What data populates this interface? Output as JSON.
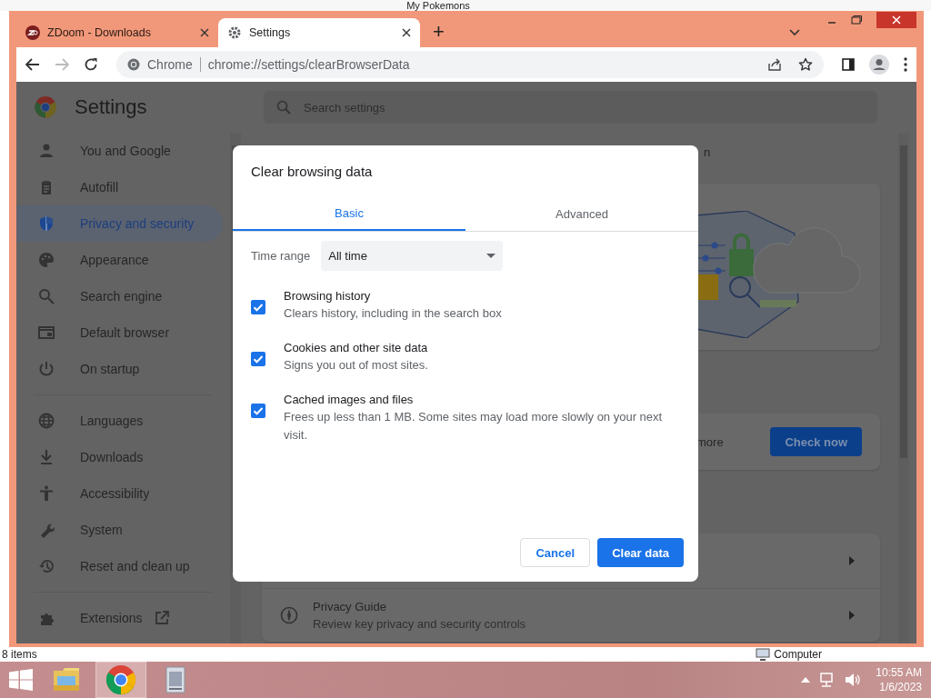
{
  "desktop": {
    "behind_window_title": "My Pokemons",
    "status_left": "8 items",
    "status_right": "Computer"
  },
  "browser": {
    "tabs": [
      {
        "title": "ZDoom - Downloads",
        "selected": false
      },
      {
        "title": "Settings",
        "selected": true
      }
    ],
    "new_tab": "+",
    "address": {
      "chip": "Chrome",
      "url": "chrome://settings/clearBrowserData"
    }
  },
  "settings": {
    "title": "Settings",
    "search": {
      "placeholder": "Search settings"
    },
    "sidebar": {
      "groups": [
        {
          "items": [
            {
              "label": "You and Google",
              "selected": false
            },
            {
              "label": "Autofill",
              "selected": false
            },
            {
              "label": "Privacy and security",
              "selected": true
            },
            {
              "label": "Appearance",
              "selected": false
            },
            {
              "label": "Search engine",
              "selected": false
            },
            {
              "label": "Default browser",
              "selected": false
            },
            {
              "label": "On startup",
              "selected": false
            }
          ]
        },
        {
          "items": [
            {
              "label": "Languages",
              "selected": false
            },
            {
              "label": "Downloads",
              "selected": false
            },
            {
              "label": "Accessibility",
              "selected": false
            },
            {
              "label": "System",
              "selected": false
            },
            {
              "label": "Reset and clean up",
              "selected": false
            }
          ]
        },
        {
          "items": [
            {
              "label": "Extensions",
              "selected": false,
              "external": true
            }
          ]
        }
      ]
    },
    "main": {
      "heading_fragment": "n",
      "safety_check": {
        "text_fragment": "more",
        "button": "Check now"
      },
      "rows": [
        {
          "title": "Privacy Guide",
          "subtitle": "Review key privacy and security controls"
        }
      ]
    }
  },
  "dialog": {
    "title": "Clear browsing data",
    "tabs": [
      {
        "label": "Basic",
        "selected": true
      },
      {
        "label": "Advanced",
        "selected": false
      }
    ],
    "time_range": {
      "label": "Time range",
      "value": "All time"
    },
    "options": [
      {
        "title": "Browsing history",
        "description": "Clears history, including in the search box",
        "checked": true
      },
      {
        "title": "Cookies and other site data",
        "description": "Signs you out of most sites.",
        "checked": true
      },
      {
        "title": "Cached images and files",
        "description": "Frees up less than 1 MB. Some sites may load more slowly on your next visit.",
        "checked": true
      }
    ],
    "buttons": [
      {
        "label": "Cancel",
        "kind": "secondary"
      },
      {
        "label": "Clear data",
        "kind": "primary"
      }
    ]
  },
  "taskbar": {
    "apps": [
      {
        "selected": false
      },
      {
        "selected": true
      },
      {
        "selected": false
      }
    ],
    "time": "10:55 AM",
    "date": "1/6/2023"
  }
}
